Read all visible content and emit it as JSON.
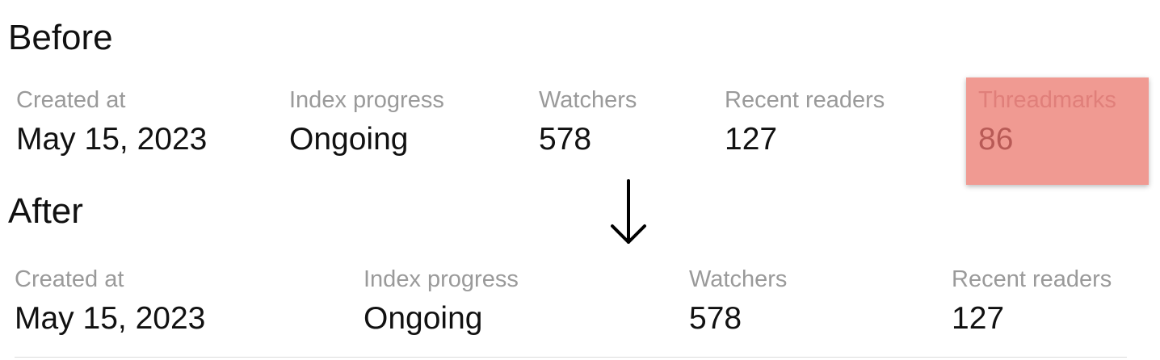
{
  "before": {
    "title": "Before",
    "stats": [
      {
        "label": "Created at",
        "value": "May 15, 2023"
      },
      {
        "label": "Index progress",
        "value": "Ongoing"
      },
      {
        "label": "Watchers",
        "value": "578"
      },
      {
        "label": "Recent readers",
        "value": "127"
      },
      {
        "label": "Threadmarks",
        "value": "86",
        "highlighted": true
      }
    ]
  },
  "after": {
    "title": "After",
    "stats": [
      {
        "label": "Created at",
        "value": "May 15, 2023"
      },
      {
        "label": "Index progress",
        "value": "Ongoing"
      },
      {
        "label": "Watchers",
        "value": "578"
      },
      {
        "label": "Recent readers",
        "value": "127"
      }
    ]
  },
  "arrow_icon": "arrow-down-icon",
  "colors": {
    "label": "#9a9a9a",
    "value": "#111111",
    "highlight_bg": "#f09a92",
    "highlight_label": "#e07f7a",
    "highlight_value": "#b85a56"
  }
}
